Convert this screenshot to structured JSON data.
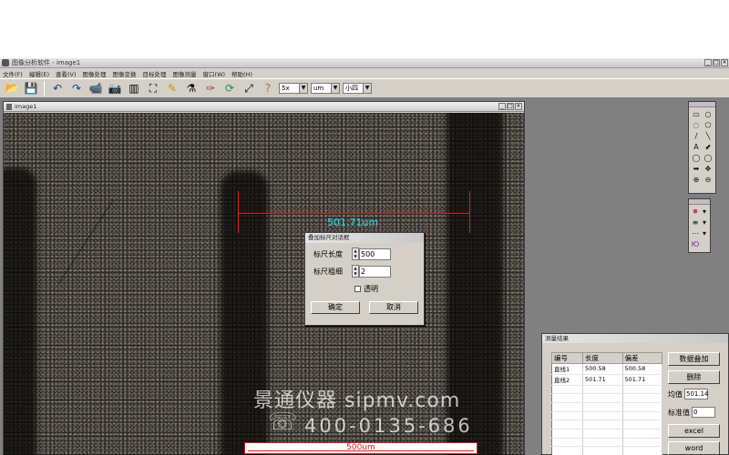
{
  "window": {
    "title": "图像分析软件 - image1",
    "controls": [
      "_",
      "□",
      "×"
    ]
  },
  "menu": [
    "文件(F)",
    "编辑(E)",
    "查看(V)",
    "图像处理",
    "图像变换",
    "目标处理",
    "图像测量",
    "窗口(W)",
    "帮助(H)"
  ],
  "toolbar": {
    "icons": [
      "open-folder-icon",
      "save-disk-icon",
      "undo-icon",
      "redo-icon",
      "video-camera-icon",
      "camera-icon",
      "histogram-icon",
      "scan-icon",
      "pencil-icon",
      "measure-tool-icon",
      "brush-icon",
      "refresh-icon",
      "capture-icon",
      "help-icon"
    ],
    "glyphs": [
      "📂",
      "💾",
      "↶",
      "↷",
      "📹",
      "📷",
      "▥",
      "⛶",
      "✎",
      "⚗",
      "✑",
      "⟳",
      "⤢",
      "?"
    ],
    "objective": "5x",
    "unit": "um",
    "font": "小四"
  },
  "image_window": {
    "title": "image1",
    "measurement_label": "501.71um",
    "scalebar_label": "500um",
    "watermark_text": "景通仪器 sipmv.com",
    "watermark_phone": "400-0135-686"
  },
  "dialog": {
    "title": "叠加标尺对话框",
    "length_label": "标尺长度",
    "length_value": "500",
    "thickness_label": "标尺粗细",
    "thickness_value": "2",
    "transparent_label": "透明",
    "ok_label": "确定",
    "cancel_label": "取消"
  },
  "palette1": [
    "▭",
    "○",
    "◌",
    "⬠",
    "/",
    "╲",
    "A",
    "⬋",
    "◯",
    "◯",
    "➡",
    "✥",
    "⊕",
    "⊖"
  ],
  "palette2": [
    "✸",
    "▾",
    "≡",
    "▾",
    "⋯",
    "▾",
    "Ю",
    ""
  ],
  "results": {
    "title": "测量结果",
    "headers": [
      "编号",
      "长度",
      "偏差"
    ],
    "rows": [
      [
        "直线1",
        "500.58",
        "500.58"
      ],
      [
        "直线2",
        "501.71",
        "501.71"
      ]
    ],
    "overlay_button": "数据叠加",
    "delete_button": "删除",
    "mean_label": "均值",
    "mean_value": "501.14",
    "std_label": "标准值",
    "std_value": "0",
    "excel_button": "excel",
    "word_button": "word"
  },
  "colors": {
    "measure_line": "#d42020",
    "measure_label": "#26e0e8"
  }
}
